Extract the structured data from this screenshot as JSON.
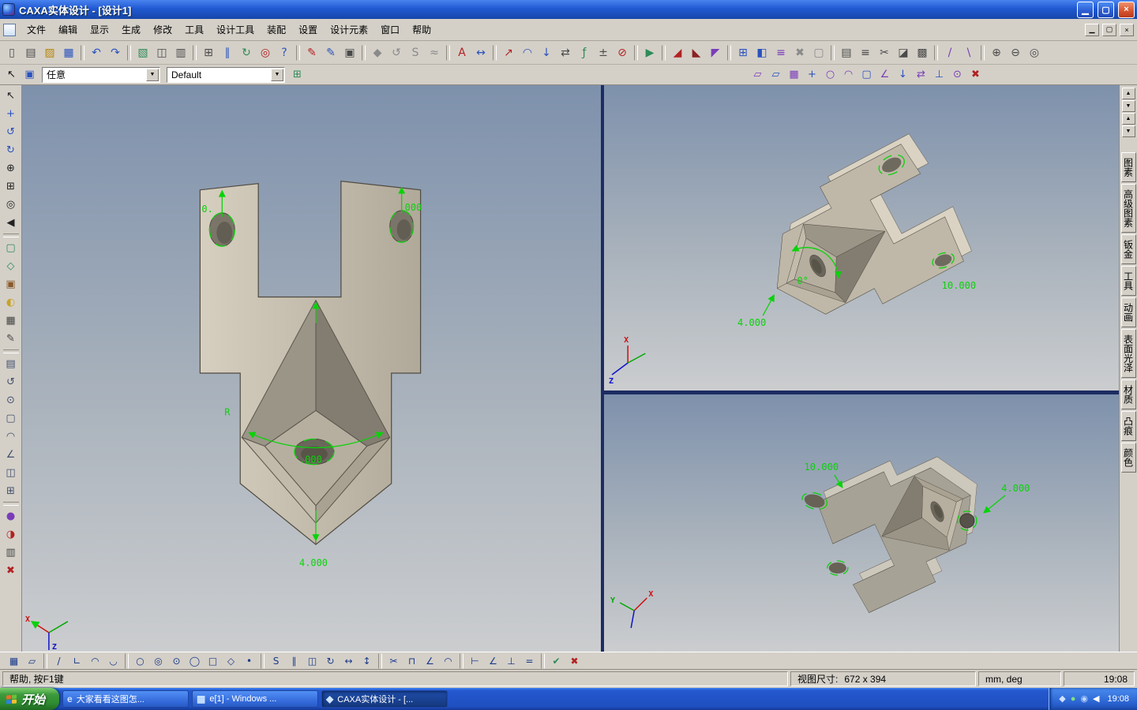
{
  "window": {
    "title": "CAXA实体设计 - [设计1]",
    "controls": {
      "minimize": "▁",
      "restore": "▢",
      "close": "×"
    }
  },
  "menu": {
    "items": [
      {
        "id": "menu-file",
        "label": "文件"
      },
      {
        "id": "menu-edit",
        "label": "编辑"
      },
      {
        "id": "menu-view",
        "label": "显示"
      },
      {
        "id": "menu-generate",
        "label": "生成"
      },
      {
        "id": "menu-modify",
        "label": "修改"
      },
      {
        "id": "menu-tools",
        "label": "工具"
      },
      {
        "id": "menu-design-tools",
        "label": "设计工具"
      },
      {
        "id": "menu-assembly",
        "label": "装配"
      },
      {
        "id": "menu-settings",
        "label": "设置"
      },
      {
        "id": "menu-design-elements",
        "label": "设计元素"
      },
      {
        "id": "menu-window",
        "label": "窗口"
      },
      {
        "id": "menu-help",
        "label": "帮助"
      }
    ],
    "mdi_controls": {
      "minimize": "▁",
      "restore": "▢",
      "close": "×"
    }
  },
  "toolbar_main": {
    "buttons": [
      {
        "name": "new-file",
        "glyph": "▯",
        "color": "#4a4a4a"
      },
      {
        "name": "new-design",
        "glyph": "▤",
        "color": "#4a4a4a"
      },
      {
        "name": "open",
        "glyph": "▨",
        "color": "#b8860b"
      },
      {
        "name": "save",
        "glyph": "▦",
        "color": "#2a52be"
      },
      {
        "name": "sep"
      },
      {
        "name": "undo",
        "glyph": "↶",
        "color": "#2a52be"
      },
      {
        "name": "redo",
        "glyph": "↷",
        "color": "#2a52be"
      },
      {
        "name": "sep"
      },
      {
        "name": "format-painter",
        "glyph": "▧",
        "color": "#2e8b57"
      },
      {
        "name": "copy",
        "glyph": "◫",
        "color": "#4a4a4a"
      },
      {
        "name": "print",
        "glyph": "▥",
        "color": "#4a4a4a"
      },
      {
        "name": "sep"
      },
      {
        "name": "check-names",
        "glyph": "⊞",
        "color": "#4a4a4a"
      },
      {
        "name": "pause-update",
        "glyph": "∥",
        "color": "#2a52be"
      },
      {
        "name": "refresh-view",
        "glyph": "↻",
        "color": "#2e8b57"
      },
      {
        "name": "select-target",
        "glyph": "◎",
        "color": "#b22222"
      },
      {
        "name": "context-help",
        "glyph": "?",
        "color": "#2a52be"
      },
      {
        "name": "sep"
      },
      {
        "name": "sketch-profile",
        "glyph": "✎",
        "color": "#b22222"
      },
      {
        "name": "sketch-3d-curve",
        "glyph": "✎",
        "color": "#2a52be"
      },
      {
        "name": "options",
        "glyph": "▣",
        "color": "#4a4a4a"
      },
      {
        "name": "sep"
      },
      {
        "name": "extrude-feature",
        "glyph": "◆",
        "color": "#8a8a8a"
      },
      {
        "name": "revolve-feature",
        "glyph": "↺",
        "color": "#8a8a8a"
      },
      {
        "name": "sweep-feature",
        "glyph": "S",
        "color": "#8a8a8a"
      },
      {
        "name": "loft-feature",
        "glyph": "≈",
        "color": "#8a8a8a"
      },
      {
        "name": "sep"
      },
      {
        "name": "annotation-text",
        "glyph": "A",
        "color": "#b22222"
      },
      {
        "name": "dimension-tool",
        "glyph": "↔",
        "color": "#2a52be"
      },
      {
        "name": "sep"
      },
      {
        "name": "trajectory",
        "glyph": "↗",
        "color": "#b22222"
      },
      {
        "name": "bend-tool",
        "glyph": "◠",
        "color": "#2a52be"
      },
      {
        "name": "direction-down",
        "glyph": "↓",
        "color": "#2a52be"
      },
      {
        "name": "swap-direction",
        "glyph": "⇄",
        "color": "#4a4a4a"
      },
      {
        "name": "equation",
        "glyph": "ƒ",
        "color": "#2e8b57"
      },
      {
        "name": "tolerance",
        "glyph": "±",
        "color": "#4a4a4a"
      },
      {
        "name": "no-snap",
        "glyph": "⊘",
        "color": "#b22222"
      },
      {
        "name": "sep"
      },
      {
        "name": "simulate",
        "glyph": "▶",
        "color": "#2e8b57"
      },
      {
        "name": "sep"
      },
      {
        "name": "section-x",
        "glyph": "◢",
        "color": "#b22222"
      },
      {
        "name": "section-y",
        "glyph": "◣",
        "color": "#8b2222"
      },
      {
        "name": "section-z",
        "glyph": "◤",
        "color": "#7a3db8"
      },
      {
        "name": "sep"
      },
      {
        "name": "pattern",
        "glyph": "⊞",
        "color": "#2a52be"
      },
      {
        "name": "shade-mode",
        "glyph": "◧",
        "color": "#2a52be"
      },
      {
        "name": "wireframe-mode",
        "glyph": "≡",
        "color": "#7a3db8"
      },
      {
        "name": "suppress",
        "glyph": "✖",
        "color": "#8a8a8a"
      },
      {
        "name": "block-tool",
        "glyph": "▢",
        "color": "#8a8a8a"
      },
      {
        "name": "sep"
      },
      {
        "name": "bom-table",
        "glyph": "▤",
        "color": "#4a4a4a"
      },
      {
        "name": "part-list",
        "glyph": "≡",
        "color": "#4a4a4a"
      },
      {
        "name": "trim-tool",
        "glyph": "✂",
        "color": "#4a4a4a"
      },
      {
        "name": "group-parts",
        "glyph": "◪",
        "color": "#4a4a4a"
      },
      {
        "name": "layer-manager",
        "glyph": "▩",
        "color": "#4a4a4a"
      },
      {
        "name": "sep"
      },
      {
        "name": "measure-distance",
        "glyph": "/",
        "color": "#7a3db8"
      },
      {
        "name": "measure-angle",
        "glyph": "\\",
        "color": "#7a3db8"
      },
      {
        "name": "sep"
      },
      {
        "name": "zoom-in",
        "glyph": "⊕",
        "color": "#4a4a4a"
      },
      {
        "name": "zoom-out",
        "glyph": "⊖",
        "color": "#4a4a4a"
      },
      {
        "name": "zoom-select",
        "glyph": "◎",
        "color": "#4a4a4a"
      }
    ]
  },
  "toolbar_context": {
    "pointer_buttons": [
      {
        "name": "select-tool",
        "glyph": "↖",
        "color": "#111111"
      },
      {
        "name": "select-box-tool",
        "glyph": "▣",
        "color": "#2a52be"
      }
    ],
    "filter_dropdown": {
      "value": "任意"
    },
    "style_dropdown": {
      "value": "Default"
    },
    "tree_button": {
      "glyph": "⊞",
      "color": "#2e8b57"
    },
    "sketch_buttons": [
      {
        "name": "plane-xy",
        "glyph": "▱",
        "color": "#7a3db8"
      },
      {
        "name": "plane-yz",
        "glyph": "▱",
        "color": "#2a52be"
      },
      {
        "name": "sketch-grid",
        "glyph": "▦",
        "color": "#7a3db8"
      },
      {
        "name": "move-plane",
        "glyph": "+",
        "color": "#2a52be"
      },
      {
        "name": "sketch-circle",
        "glyph": "○",
        "color": "#7a3db8"
      },
      {
        "name": "sketch-arc",
        "glyph": "◠",
        "color": "#7a3db8"
      },
      {
        "name": "sketch-box",
        "glyph": "▢",
        "color": "#2a52be"
      },
      {
        "name": "sketch-angle",
        "glyph": "∠",
        "color": "#7a3db8"
      },
      {
        "name": "project-curve",
        "glyph": "↓",
        "color": "#2a52be"
      },
      {
        "name": "flip-plane",
        "glyph": "⇄",
        "color": "#7a3db8"
      },
      {
        "name": "normal-view",
        "glyph": "⊥",
        "color": "#2a52be"
      },
      {
        "name": "attach-point",
        "glyph": "⊙",
        "color": "#7a3db8"
      },
      {
        "name": "cancel-sketch",
        "glyph": "✖",
        "color": "#b22222"
      }
    ]
  },
  "left_toolbar": {
    "buttons": [
      {
        "name": "select",
        "glyph": "↖",
        "color": "#222222"
      },
      {
        "name": "pan-view",
        "glyph": "+",
        "color": "#2a52be"
      },
      {
        "name": "rotate-view",
        "glyph": "↺",
        "color": "#2a52be"
      },
      {
        "name": "spin-view",
        "glyph": "↻",
        "color": "#2a52be"
      },
      {
        "name": "zoom-in-view",
        "glyph": "⊕",
        "color": "#222222"
      },
      {
        "name": "zoom-window",
        "glyph": "⊞",
        "color": "#222222"
      },
      {
        "name": "zoom-fit",
        "glyph": "◎",
        "color": "#222222"
      },
      {
        "name": "previous-view",
        "glyph": "◀",
        "color": "#222222"
      },
      {
        "name": "sep"
      },
      {
        "name": "front-view",
        "glyph": "▢",
        "color": "#2e8b57"
      },
      {
        "name": "iso-view",
        "glyph": "◇",
        "color": "#2e8b57"
      },
      {
        "name": "camera-view",
        "glyph": "▣",
        "color": "#8a5a2a"
      },
      {
        "name": "render-mode",
        "glyph": "◐",
        "color": "#c9a227"
      },
      {
        "name": "wireframe-toggle",
        "glyph": "▦",
        "color": "#444444"
      },
      {
        "name": "redline-pen",
        "glyph": "✎",
        "color": "#444444"
      },
      {
        "name": "sep"
      },
      {
        "name": "extrude",
        "glyph": "▤",
        "color": "#44506e"
      },
      {
        "name": "revolve",
        "glyph": "↺",
        "color": "#44506e"
      },
      {
        "name": "hole",
        "glyph": "⊙",
        "color": "#44506e"
      },
      {
        "name": "shell",
        "glyph": "▢",
        "color": "#44506e"
      },
      {
        "name": "fillet",
        "glyph": "◠",
        "color": "#44506e"
      },
      {
        "name": "chamfer",
        "glyph": "∠",
        "color": "#44506e"
      },
      {
        "name": "mirror-feature",
        "glyph": "◫",
        "color": "#44506e"
      },
      {
        "name": "array-feature",
        "glyph": "⊞",
        "color": "#44506e"
      },
      {
        "name": "sep"
      },
      {
        "name": "material",
        "glyph": "●",
        "color": "#7a3db8"
      },
      {
        "name": "color-tool",
        "glyph": "◑",
        "color": "#b22222"
      },
      {
        "name": "properties",
        "glyph": "▥",
        "color": "#444444"
      },
      {
        "name": "erase",
        "glyph": "✖",
        "color": "#b22222"
      }
    ]
  },
  "right_panel": {
    "scroll_buttons": [
      {
        "name": "scroll-up",
        "glyph": "▲"
      },
      {
        "name": "scroll-down",
        "glyph": "▼"
      },
      {
        "name": "page-up",
        "glyph": "▲"
      },
      {
        "name": "page-down",
        "glyph": "▼"
      }
    ],
    "tabs": [
      {
        "id": "tab-primitives",
        "label": "图素"
      },
      {
        "id": "tab-advanced-primitives",
        "label": "高级图素"
      },
      {
        "id": "tab-sheet-metal",
        "label": "钣金"
      },
      {
        "id": "tab-tools",
        "label": "工具"
      },
      {
        "id": "tab-animation",
        "label": "动画"
      },
      {
        "id": "tab-surface-finish",
        "label": "表面光泽"
      },
      {
        "id": "tab-material",
        "label": "材质"
      },
      {
        "id": "tab-bump",
        "label": "凸痕"
      },
      {
        "id": "tab-color",
        "label": "颜色"
      }
    ]
  },
  "viewports": {
    "front": {
      "dims": {
        "left_hole": "0.",
        "right_hole": "000",
        "center_hole": ".000",
        "radius": "R",
        "height": "4.000"
      },
      "axis": {
        "x": "X",
        "z": "Z"
      }
    },
    "iso_top": {
      "dims": {
        "width": "4.000",
        "hole": "10.000",
        "angle": "0°"
      },
      "axis": {
        "x": "X",
        "z": "Z"
      }
    },
    "iso_bottom": {
      "dims": {
        "length": "10.000",
        "width": "4.000"
      },
      "axis": {
        "x": "X",
        "y": "Y"
      }
    }
  },
  "bottom_toolbar": {
    "buttons": [
      {
        "name": "sketch-grid",
        "glyph": "▦",
        "color": "#1a3a8a"
      },
      {
        "name": "work-plane",
        "glyph": "▱",
        "color": "#1a3a8a"
      },
      {
        "name": "sep"
      },
      {
        "name": "line",
        "glyph": "/",
        "color": "#1a3a8a"
      },
      {
        "name": "polyline",
        "glyph": "∟",
        "color": "#1a3a8a"
      },
      {
        "name": "arc",
        "glyph": "◠",
        "color": "#1a3a8a"
      },
      {
        "name": "arc-3pt",
        "glyph": "◡",
        "color": "#1a3a8a"
      },
      {
        "name": "sep"
      },
      {
        "name": "circle",
        "glyph": "○",
        "color": "#1a3a8a"
      },
      {
        "name": "circle-concentric",
        "glyph": "◎",
        "color": "#1a3a8a"
      },
      {
        "name": "circle-tangent",
        "glyph": "⊙",
        "color": "#1a3a8a"
      },
      {
        "name": "ellipse",
        "glyph": "◯",
        "color": "#1a3a8a"
      },
      {
        "name": "rectangle",
        "glyph": "□",
        "color": "#1a3a8a"
      },
      {
        "name": "polygon",
        "glyph": "◇",
        "color": "#1a3a8a"
      },
      {
        "name": "point",
        "glyph": "•",
        "color": "#1a3a8a"
      },
      {
        "name": "sep"
      },
      {
        "name": "spline",
        "glyph": "S",
        "color": "#1a3a8a"
      },
      {
        "name": "offset",
        "glyph": "∥",
        "color": "#1a3a8a"
      },
      {
        "name": "mirror",
        "glyph": "◫",
        "color": "#1a3a8a"
      },
      {
        "name": "rotate",
        "glyph": "↻",
        "color": "#1a3a8a"
      },
      {
        "name": "move",
        "glyph": "↔",
        "color": "#1a3a8a"
      },
      {
        "name": "stretch",
        "glyph": "↕",
        "color": "#1a3a8a"
      },
      {
        "name": "sep"
      },
      {
        "name": "trim",
        "glyph": "✂",
        "color": "#1a3a8a"
      },
      {
        "name": "corner",
        "glyph": "⊓",
        "color": "#1a3a8a"
      },
      {
        "name": "chamfer",
        "glyph": "∠",
        "color": "#1a3a8a"
      },
      {
        "name": "fillet",
        "glyph": "◠",
        "color": "#1a3a8a"
      },
      {
        "name": "sep"
      },
      {
        "name": "dim-linear",
        "glyph": "⊢",
        "color": "#1a3a8a"
      },
      {
        "name": "dim-angular",
        "glyph": "∠",
        "color": "#1a3a8a"
      },
      {
        "name": "constraint-perpendicular",
        "glyph": "⊥",
        "color": "#1a3a8a"
      },
      {
        "name": "constraint-equal",
        "glyph": "=",
        "color": "#1a3a8a"
      },
      {
        "name": "sep"
      },
      {
        "name": "accept",
        "glyph": "✔",
        "color": "#2e8b57"
      },
      {
        "name": "cancel",
        "glyph": "✖",
        "color": "#b22222"
      }
    ]
  },
  "status_bar": {
    "help_text": "帮助, 按F1键",
    "view_size_label": "视图尺寸:",
    "view_size_value": "672 x  394",
    "units": "mm, deg",
    "time": "19:08"
  },
  "taskbar": {
    "start_label": "开始",
    "tasks": [
      {
        "id": "task-browser",
        "icon": "e",
        "label": "大家看看这图怎..."
      },
      {
        "id": "task-windows-viewer",
        "icon": "▦",
        "label": "e[1] - Windows ..."
      },
      {
        "id": "task-caxa",
        "icon": "◆",
        "label": "CAXA实体设计 - [...",
        "active": true
      }
    ],
    "tray": {
      "icons": [
        {
          "name": "tray-ime",
          "glyph": "◆",
          "color": "#cfe2ff"
        },
        {
          "name": "tray-antivirus",
          "glyph": "●",
          "color": "#7fe07f"
        },
        {
          "name": "tray-network",
          "glyph": "◉",
          "color": "#bcd6ff"
        },
        {
          "name": "tray-volume",
          "glyph": "◀",
          "color": "#ffffff"
        }
      ],
      "time": "19:08"
    }
  },
  "colors": {
    "dimension_green": "#0ad20a",
    "titlebar_blue": "#2059d2",
    "taskbar_blue": "#2458cf",
    "start_green": "#2f8b2f",
    "toolbar_gray": "#d4d0c8",
    "viewport_top": "#7e91ac",
    "viewport_bottom": "#cbcdcf",
    "part_beige": "#c6bfaf",
    "close_red": "#d6512c",
    "axis_x_red": "#cc1111",
    "axis_y_green": "#00aa00",
    "axis_z_blue": "#1111cc"
  }
}
